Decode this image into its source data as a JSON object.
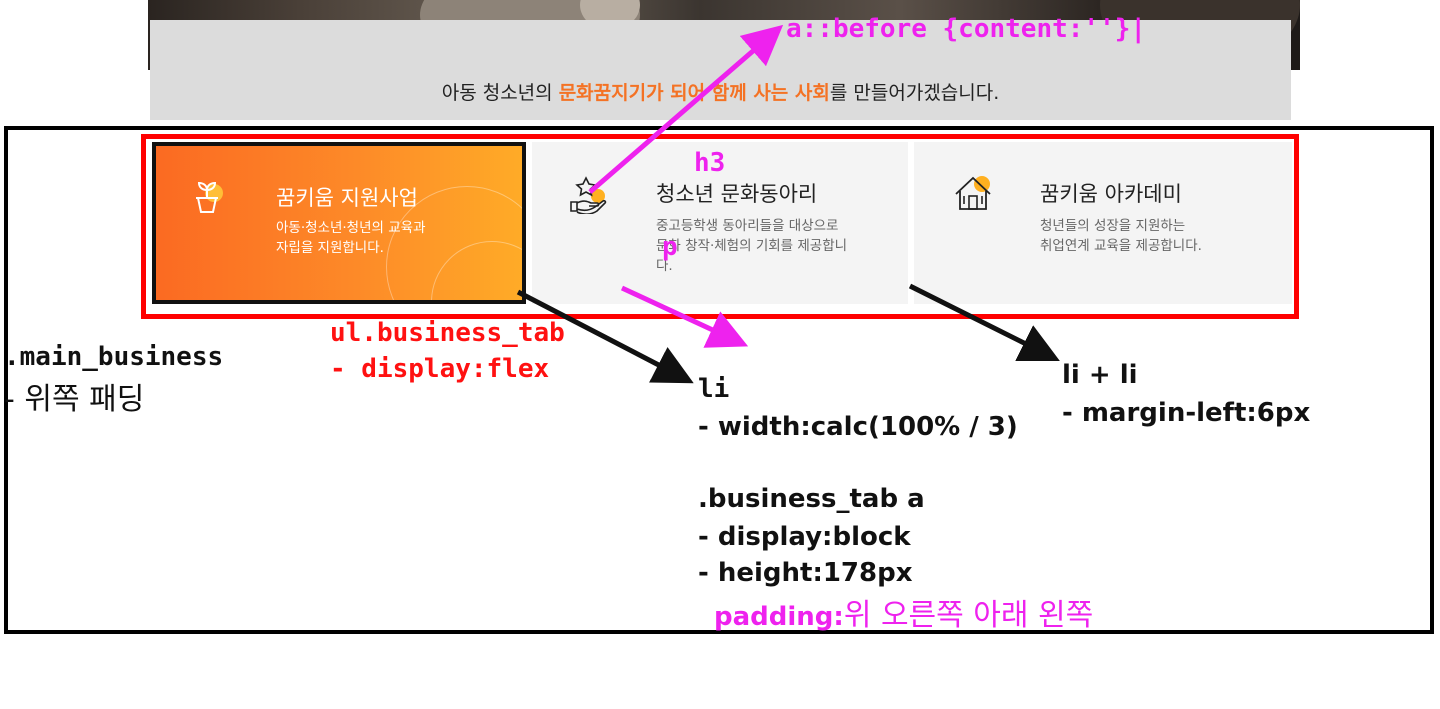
{
  "notice": {
    "before": "아동 청소년의 ",
    "highlight": "문화꿈지기가 되어 함께 사는 사회",
    "after": "를 만들어가겠습니다."
  },
  "tabs": [
    {
      "title": "꿈키움 지원사업",
      "desc": "아동·청소년·청년의 교육과\n자립을 지원합니다.",
      "icon": "plant-pot-icon",
      "active": true
    },
    {
      "title": "청소년 문화동아리",
      "desc": "중고등학생 동아리들을 대상으로\n문화 창작·체험의 기회를 제공합니\n다.",
      "icon": "hand-star-icon",
      "active": false
    },
    {
      "title": "꿈키움 아카데미",
      "desc": "청년들의 성장을 지원하는\n취업연계 교육을 제공합니다.",
      "icon": "house-icon",
      "active": false
    }
  ],
  "annotations": {
    "before": "a::before {content:''}|",
    "h3": "h3",
    "p": "p",
    "ul_title": "ul.business_tab",
    "ul_rule": "- display:flex",
    "main_title": ".main_business",
    "main_rule": "- 위쪽 패딩",
    "li_title": "li",
    "li_rule": "- width:calc(100% / 3)",
    "a_title": ".business_tab a",
    "a_rule1": "- display:block",
    "a_rule2": "- height:178px",
    "padding_label": "padding:",
    "padding_rule": "위 오른쪽 아래 왼쪽",
    "lili_title": "li + li",
    "lili_rule": "- margin-left:6px"
  },
  "colors": {
    "accent": "#f47224",
    "red": "#ff0000",
    "magenta": "#ee22ee"
  }
}
